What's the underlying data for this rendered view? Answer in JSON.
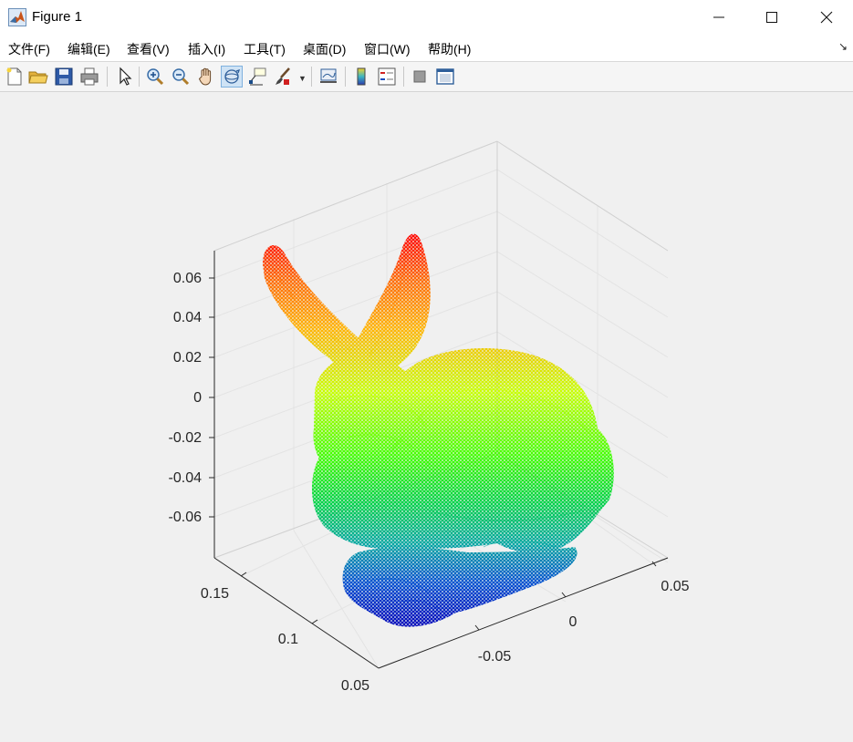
{
  "window": {
    "title": "Figure 1",
    "app_icon": "matlab-icon",
    "controls": [
      "minimize-icon",
      "maximize-icon",
      "close-icon"
    ]
  },
  "menu": {
    "items": [
      "文件(F)",
      "编辑(E)",
      "查看(V)",
      "插入(I)",
      "工具(T)",
      "桌面(D)",
      "窗口(W)",
      "帮助(H)"
    ],
    "dock_icon": "dock-arrow-icon"
  },
  "toolbar": {
    "buttons": [
      "new-figure-icon",
      "open-file-icon",
      "save-icon",
      "print-icon",
      "edit-plot-arrow-icon",
      "zoom-in-icon",
      "zoom-out-icon",
      "pan-hand-icon",
      "rotate-3d-icon",
      "data-cursor-icon",
      "brush-icon",
      "link-plot-icon",
      "colorbar-icon",
      "legend-icon",
      "hide-plot-tools-icon",
      "show-plot-tools-icon"
    ],
    "active": "rotate-3d-icon"
  },
  "axes": {
    "z_ticks": [
      "0.06",
      "0.04",
      "0.02",
      "0",
      "-0.02",
      "-0.04",
      "-0.06"
    ],
    "y_ticks": [
      "0.15",
      "0.1",
      "0.05"
    ],
    "x_ticks": [
      "0.05",
      "0",
      "-0.05"
    ],
    "colormap": "hsv",
    "grid": true,
    "box": "open 3-D axes"
  },
  "chart_data": {
    "type": "scatter",
    "title": "",
    "xlabel": "",
    "ylabel": "",
    "zlabel": "",
    "z_tick_values": [
      0.06,
      0.04,
      0.02,
      0,
      -0.02,
      -0.04,
      -0.06
    ],
    "y_tick_values": [
      0.15,
      0.1,
      0.05
    ],
    "x_tick_values": [
      0.05,
      0,
      -0.05
    ],
    "colors": {
      "top": "#ff0000",
      "middle": "#55ff00",
      "bottom": "#0000cc"
    }
  }
}
